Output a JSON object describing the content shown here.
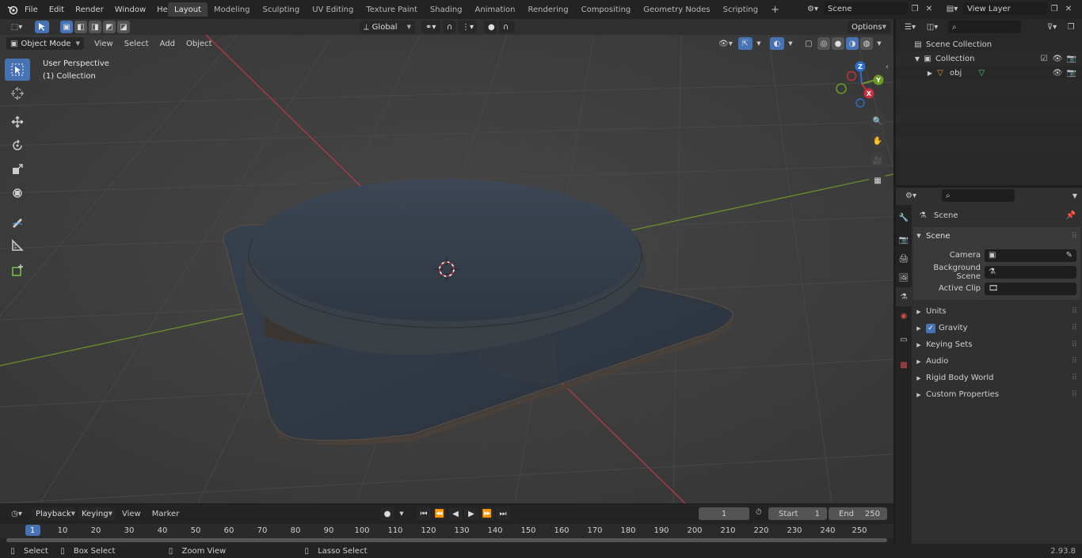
{
  "menus": [
    "File",
    "Edit",
    "Render",
    "Window",
    "Help"
  ],
  "workspaces": [
    "Layout",
    "Modeling",
    "Sculpting",
    "UV Editing",
    "Texture Paint",
    "Shading",
    "Animation",
    "Rendering",
    "Compositing",
    "Geometry Nodes",
    "Scripting"
  ],
  "active_workspace": "Layout",
  "scene_name": "Scene",
  "view_layer": "View Layer",
  "viewport": {
    "mode": "Object Mode",
    "menus": [
      "View",
      "Select",
      "Add",
      "Object"
    ],
    "transform_orientation": "Global",
    "options_label": "Options",
    "overlay_title": "User Perspective",
    "overlay_subtitle": "(1) Collection",
    "gizmo": {
      "z": "Z",
      "y": "Y",
      "x": "X"
    }
  },
  "timeline": {
    "menus": [
      "Playback",
      "Keying",
      "View",
      "Marker"
    ],
    "current_frame": "1",
    "start_label": "Start",
    "start": "1",
    "end_label": "End",
    "end": "250",
    "ruler": [
      "1",
      "10",
      "20",
      "30",
      "40",
      "50",
      "60",
      "70",
      "80",
      "90",
      "100",
      "110",
      "120",
      "130",
      "140",
      "150",
      "160",
      "170",
      "180",
      "190",
      "200",
      "210",
      "220",
      "230",
      "240",
      "250"
    ]
  },
  "status": {
    "select": "Select",
    "box_select": "Box Select",
    "zoom_view": "Zoom View",
    "lasso_select": "Lasso Select",
    "version": "2.93.8"
  },
  "outliner": {
    "scene_collection": "Scene Collection",
    "collection": "Collection",
    "object": "obj"
  },
  "properties": {
    "context": "Scene",
    "panel": "Scene",
    "camera_label": "Camera",
    "background_scene_label": "Background Scene",
    "active_clip_label": "Active Clip",
    "sections": [
      "Units",
      "Gravity",
      "Keying Sets",
      "Audio",
      "Rigid Body World",
      "Custom Properties"
    ]
  },
  "colors": {
    "accent": "#4772b3",
    "x_axis": "#c9303f",
    "y_axis": "#6b9a26",
    "z_axis": "#2f6fd0"
  }
}
